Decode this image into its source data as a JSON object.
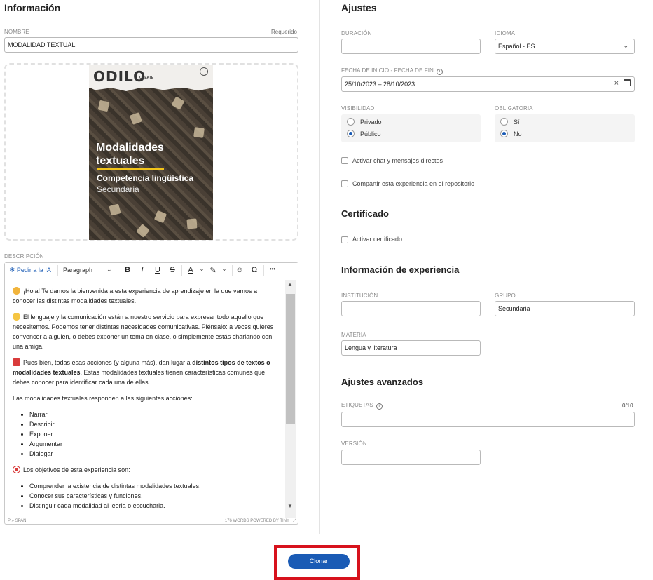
{
  "left": {
    "section_title": "Información",
    "nombre": {
      "label": "NOMBRE",
      "required": "Requerido",
      "value": "MODALIDAD TEXTUAL"
    },
    "cover": {
      "logo": "ODILO",
      "logo_sub": "CREATE",
      "title": "Modalidades textuales",
      "subtitle": "Competencia lingüística",
      "level": "Secundaria"
    },
    "descripcion": {
      "label": "DESCRIPCIÓN",
      "toolbar": {
        "ai_button": "Pedir a la IA",
        "format_select": "Paragraph",
        "bold": "B",
        "italic": "I",
        "underline": "U",
        "strike": "S",
        "font_color": "A",
        "emoji": "☺",
        "special_char": "Ω",
        "more": "•••"
      },
      "content": {
        "p1": "¡Hola! Te damos la bienvenida a esta experiencia de aprendizaje en la que vamos a conocer las distintas modalidades textuales.",
        "p2": "El lenguaje y la comunicación están a nuestro servicio para expresar todo aquello que necesitemos. Podemos tener distintas necesidades comunicativas. Piénsalo:  a veces quieres convencer a alguien, o debes exponer un tema en clase, o simplemente estás charlando con una amiga.",
        "p3_a": "Pues bien, todas esas acciones (y alguna más), dan lugar a ",
        "p3_b": "distintos tipos de textos o modalidades textuales",
        "p3_c": ". Estas modalidades textuales tienen características comunes que debes conocer para identificar cada una de ellas.",
        "p4": "Las modalidades textuales responden a las siguientes acciones:",
        "list1": [
          "Narrar",
          "Describir",
          "Exponer",
          "Argumentar",
          "Dialogar"
        ],
        "p5": "Los objetivos de esta experiencia son:",
        "list2": [
          "Comprender la existencia de distintas modalidades textuales.",
          "Conocer sus características y funciones.",
          "Distinguir cada modalidad al leerla o escucharla."
        ]
      },
      "status_left": "P » SPAN",
      "status_right": "176 WORDS  POWERED BY TINY"
    }
  },
  "right": {
    "ajustes_title": "Ajustes",
    "duracion": {
      "label": "DURACIÓN",
      "value": ""
    },
    "idioma": {
      "label": "IDIOMA",
      "value": "Español - ES"
    },
    "fechas": {
      "label": "FECHA DE INICIO - FECHA DE FIN",
      "value": "25/10/2023 – 28/10/2023"
    },
    "visibilidad": {
      "label": "VISIBILIDAD",
      "options": [
        "Privado",
        "Público"
      ],
      "selected": "Público"
    },
    "obligatoria": {
      "label": "OBLIGATORIA",
      "options": [
        "Sí",
        "No"
      ],
      "selected": "No"
    },
    "chat": {
      "label": "Activar chat y mensajes directos",
      "checked": false
    },
    "compartir": {
      "label": "Compartir esta experiencia en el repositorio",
      "checked": false
    },
    "certificado_title": "Certificado",
    "certificado": {
      "label": "Activar certificado",
      "checked": false
    },
    "info_exp_title": "Información de experiencia",
    "institucion": {
      "label": "INSTITUCIÓN",
      "value": ""
    },
    "grupo": {
      "label": "GRUPO",
      "value": "Secundaria"
    },
    "materia": {
      "label": "MATERIA",
      "value": "Lengua y literatura"
    },
    "avanzados_title": "Ajustes avanzados",
    "etiquetas": {
      "label": "ETIQUETAS",
      "counter": "0/10",
      "value": ""
    },
    "version": {
      "label": "VERSIÓN",
      "value": ""
    }
  },
  "footer": {
    "clone_button": "Clonar"
  },
  "colors": {
    "accent": "#1a5bb5",
    "highlight": "#d7121c"
  },
  "icons": [
    "snowflake-ai-icon",
    "chevron-down-icon",
    "close-icon",
    "calendar-icon",
    "info-icon",
    "resize-icon"
  ]
}
